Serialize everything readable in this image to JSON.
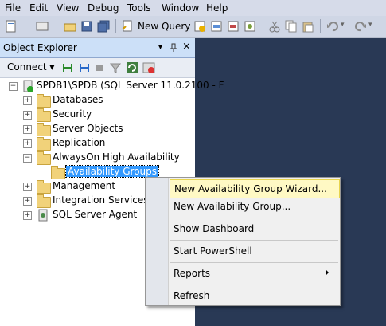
{
  "menubar": {
    "items": [
      "File",
      "Edit",
      "View",
      "Debug",
      "Tools",
      "Window",
      "Help"
    ]
  },
  "toolbar": {
    "new_query_label": "New Query"
  },
  "object_explorer": {
    "title": "Object Explorer",
    "pin_glyph": "▾",
    "close_glyph": "×",
    "connect_label": "Connect ▾",
    "server_label": "SPDB1\\SPDB (SQL Server 11.0.2100 - F",
    "nodes": {
      "databases": "Databases",
      "security": "Security",
      "server_objects": "Server Objects",
      "replication": "Replication",
      "alwayson": "AlwaysOn High Availability",
      "availability_groups": "Availability Groups",
      "management": "Management",
      "integration_services": "Integration Services Ca",
      "sql_agent": "SQL Server Agent"
    }
  },
  "context_menu": {
    "wizard": "New Availability Group Wizard...",
    "new_group": "New Availability Group...",
    "dashboard": "Show Dashboard",
    "powershell": "Start PowerShell",
    "reports": "Reports",
    "refresh": "Refresh"
  },
  "colors": {
    "workspace": "#293955",
    "highlight": "#fff9c4",
    "selection": "#3399ff"
  }
}
